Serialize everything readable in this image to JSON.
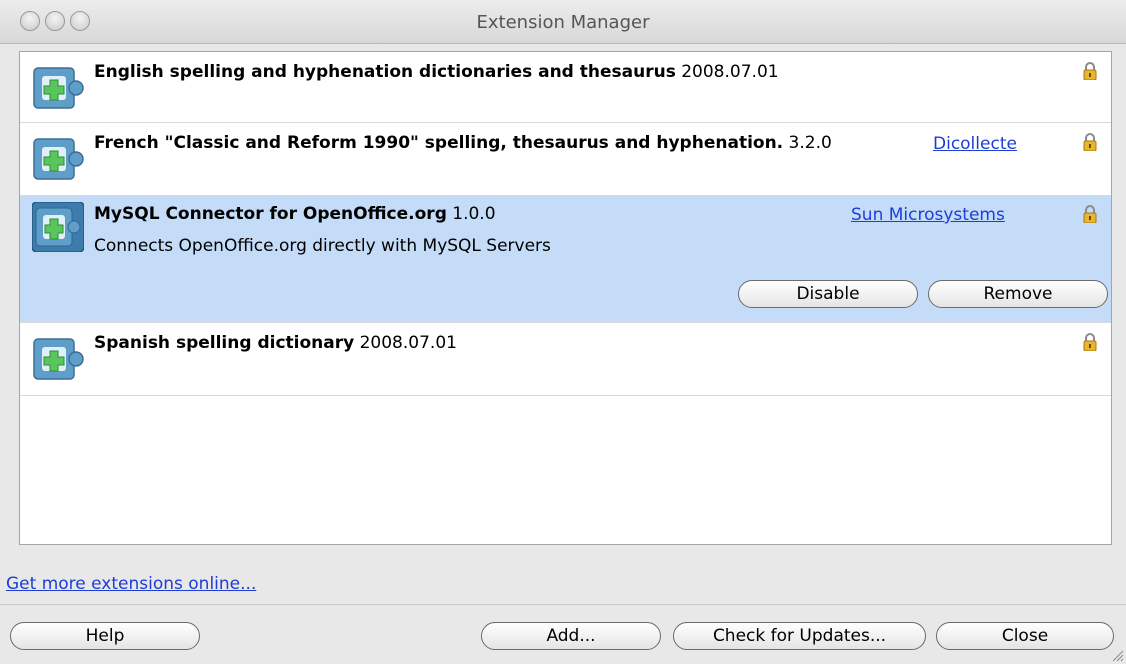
{
  "window": {
    "title": "Extension Manager"
  },
  "extensions": [
    {
      "name": "English spelling and hyphenation dictionaries and thesaurus",
      "version": "2008.07.01",
      "publisher": "",
      "description": "",
      "selected": false,
      "icon": "puzzle-icon"
    },
    {
      "name": "French \"Classic and Reform 1990\" spelling, thesaurus and hyphenation.",
      "version": "3.2.0",
      "publisher": "Dicollecte",
      "description": "",
      "selected": false,
      "icon": "puzzle-icon"
    },
    {
      "name": "MySQL Connector for OpenOffice.org",
      "version": "1.0.0",
      "publisher": "Sun Microsystems",
      "description": "Connects OpenOffice.org directly with MySQL Servers",
      "selected": true,
      "icon": "puzzle-icon"
    },
    {
      "name": "Spanish spelling dictionary",
      "version": "2008.07.01",
      "publisher": "",
      "description": "",
      "selected": false,
      "icon": "puzzle-icon"
    }
  ],
  "selected_actions": {
    "disable": "Disable",
    "remove": "Remove"
  },
  "more_link": "Get more extensions online...",
  "buttons": {
    "help": "Help",
    "add": "Add...",
    "check_updates": "Check for Updates...",
    "close": "Close"
  },
  "colors": {
    "selection": "#c4dcf7",
    "link": "#1d3dd6",
    "icon_blue": "#5f9ec8",
    "icon_plus": "#58c65a",
    "lock_gold": "#e8b530"
  }
}
